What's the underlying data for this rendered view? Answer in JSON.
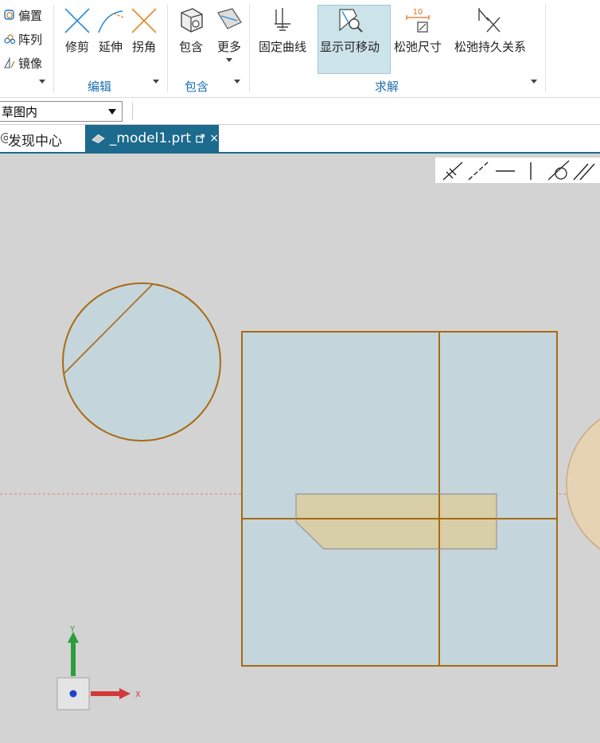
{
  "ribbon": {
    "small_buttons": [
      {
        "label": "偏置",
        "icon": "offset-icon"
      },
      {
        "label": "阵列",
        "icon": "pattern-icon"
      },
      {
        "label": "镜像",
        "icon": "mirror-icon"
      }
    ],
    "edit_buttons": [
      {
        "label": "修剪",
        "icon": "trim-icon"
      },
      {
        "label": "延伸",
        "icon": "extend-icon"
      },
      {
        "label": "拐角",
        "icon": "corner-icon"
      }
    ],
    "contain_buttons": [
      {
        "label": "包含",
        "icon": "contain-icon"
      },
      {
        "label": "更多",
        "icon": "more-icon"
      }
    ],
    "solve_buttons": [
      {
        "label": "固定曲线",
        "icon": "fix-curve-icon"
      },
      {
        "label": "显示可移动",
        "icon": "show-movable-icon"
      },
      {
        "label": "松弛尺寸",
        "icon": "relax-dimension-icon",
        "badge": "10"
      },
      {
        "label": "松弛持久关系",
        "icon": "relax-relations-icon"
      }
    ],
    "groups": {
      "edit": "编辑",
      "contain": "包含",
      "solve": "求解"
    }
  },
  "toolbar": {
    "dropdown_value": "草图内"
  },
  "tabs": {
    "first": "发现中心",
    "active": "_model1.prt",
    "close": "×"
  },
  "axes": {
    "x": "X",
    "y": "Y"
  },
  "colors": {
    "accent": "#1c6a8d",
    "curve": "#a86a12",
    "fill": "#c5d5dc",
    "highlight": "#d9cda2",
    "active_button": "#cde3ea"
  }
}
